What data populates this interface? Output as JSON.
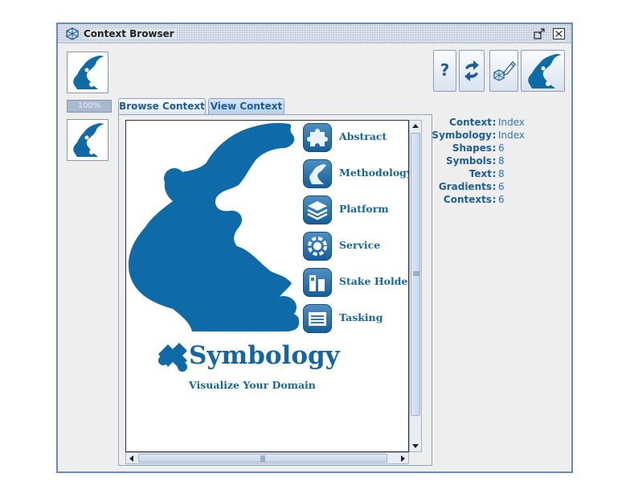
{
  "window": {
    "title": "Context Browser",
    "zoom_label": "100%"
  },
  "tabs": [
    {
      "label": "Browse Context",
      "active": false
    },
    {
      "label": "View Context",
      "active": true
    }
  ],
  "toolbar": {
    "help_glyph": "?",
    "icons": [
      "help-icon",
      "refresh-icon",
      "edit-context-icon",
      "context-thumbnail-icon"
    ]
  },
  "menu": [
    {
      "label": "Abstract",
      "icon": "puzzle-piece-icon"
    },
    {
      "label": "Methodology",
      "icon": "head-profile-icon"
    },
    {
      "label": "Platform",
      "icon": "stacked-layers-icon"
    },
    {
      "label": "Service",
      "icon": "gear-puzzle-icon"
    },
    {
      "label": "Stake Holder",
      "icon": "stakeholders-icon"
    },
    {
      "label": "Tasking",
      "icon": "task-list-icon"
    }
  ],
  "brand": {
    "title": "Symbology",
    "tagline": "Visualize Your Domain"
  },
  "info": [
    {
      "key": "Context",
      "value": "Index"
    },
    {
      "key": "Symbology",
      "value": "Index"
    },
    {
      "key": "Shapes",
      "value": "6"
    },
    {
      "key": "Symbols",
      "value": "8"
    },
    {
      "key": "Text",
      "value": "8"
    },
    {
      "key": "Gradients",
      "value": "6"
    },
    {
      "key": "Contexts",
      "value": "6"
    }
  ],
  "colors": {
    "brand_blue": "#1565a2",
    "window_border": "#6d89b6",
    "logo_blue": "#0f6aa8"
  }
}
